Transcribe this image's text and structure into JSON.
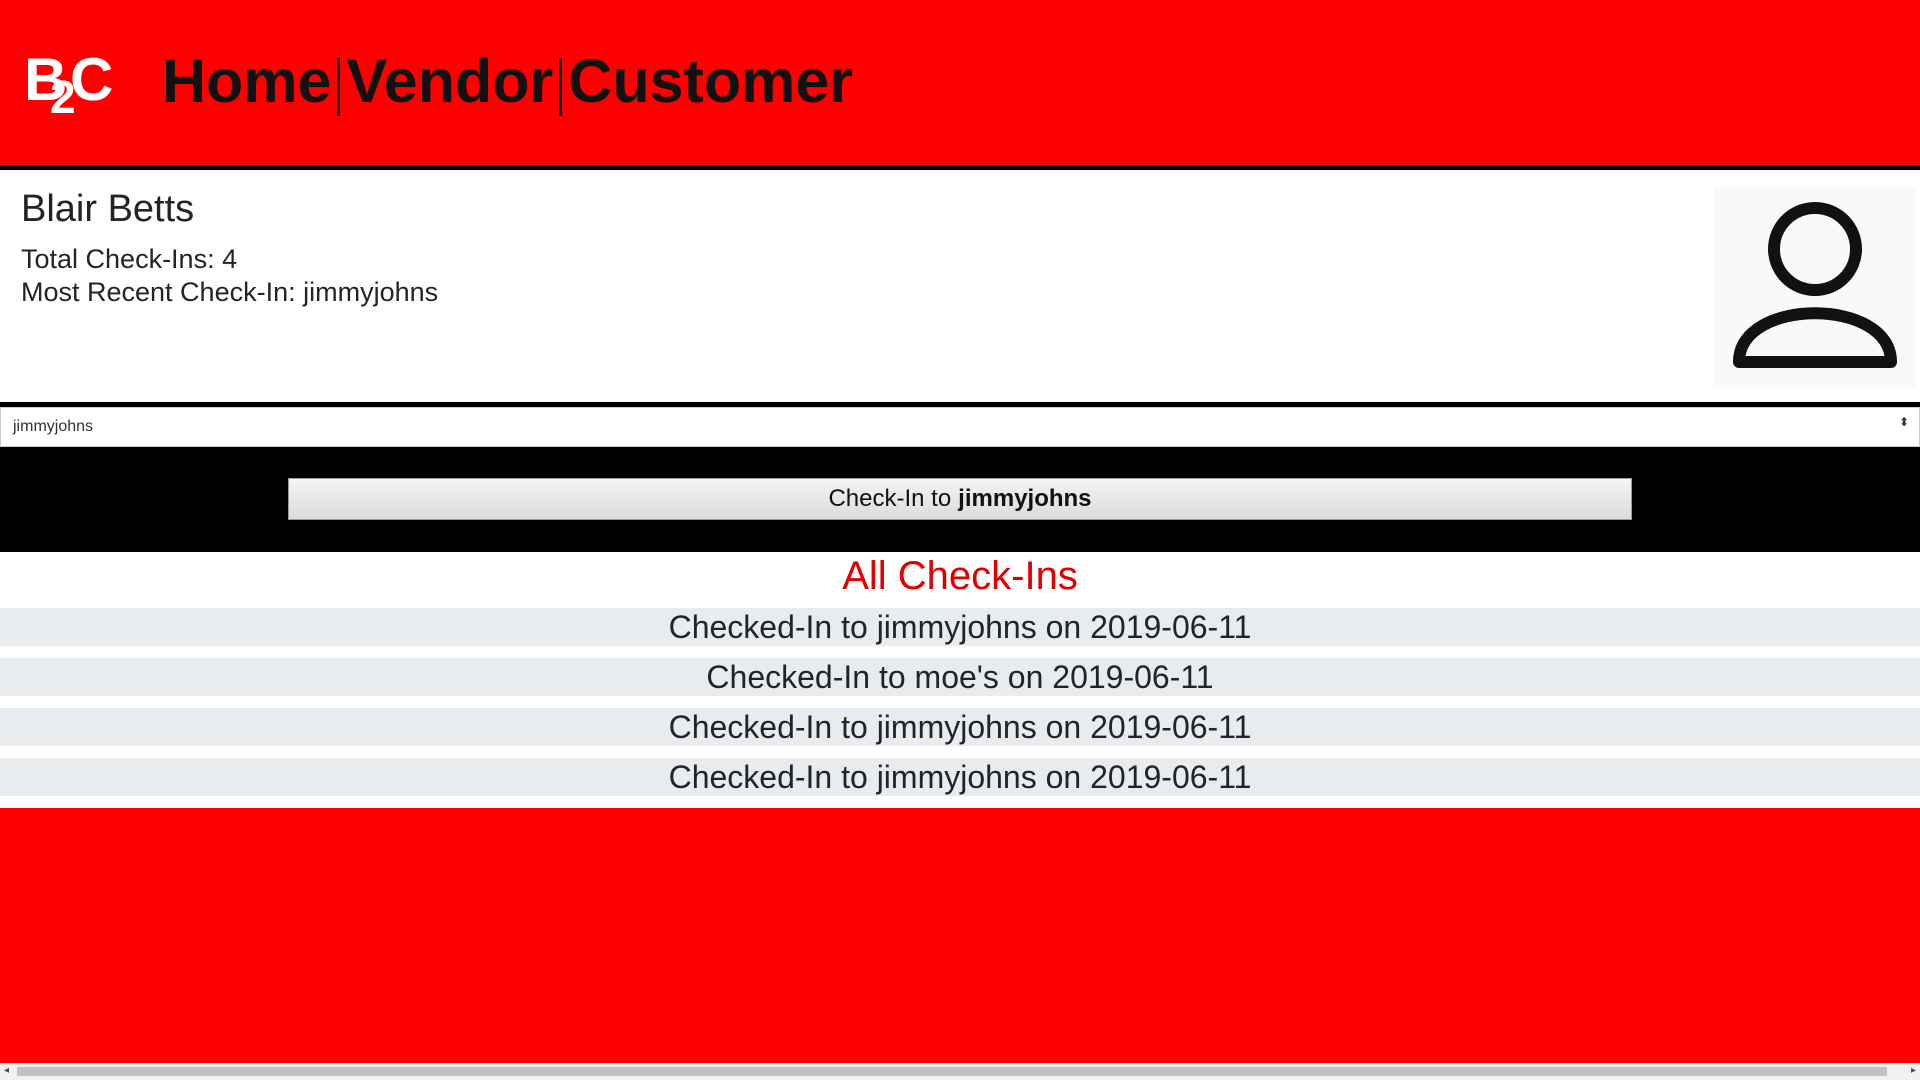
{
  "header": {
    "logo": {
      "b": "B",
      "two": "2",
      "c": "C"
    },
    "nav": [
      {
        "label": "Home"
      },
      {
        "label": "Vendor"
      },
      {
        "label": "Customer"
      }
    ]
  },
  "profile": {
    "name": "Blair Betts",
    "total_checkins": "Total Check-Ins: 4",
    "recent_checkin": "Most Recent Check-In: jimmyjohns",
    "avatar_icon": "user-icon"
  },
  "vendor_select": {
    "value": "jimmyjohns",
    "arrows": "⬍"
  },
  "checkin_button": {
    "prefix": "Check-In to",
    "vendor": "jimmyjohns"
  },
  "history": {
    "heading": "All Check-Ins",
    "items": [
      "Checked-In to jimmyjohns on 2019-06-11",
      "Checked-In to moe's on 2019-06-11",
      "Checked-In to jimmyjohns on 2019-06-11",
      "Checked-In to jimmyjohns on 2019-06-11"
    ]
  },
  "scrollbar": {
    "left_arrow": "◂",
    "right_arrow": "▸"
  },
  "colors": {
    "brand_red": "#ff0000",
    "heading_red": "#e00000",
    "row_gray": "#e9ecef"
  }
}
